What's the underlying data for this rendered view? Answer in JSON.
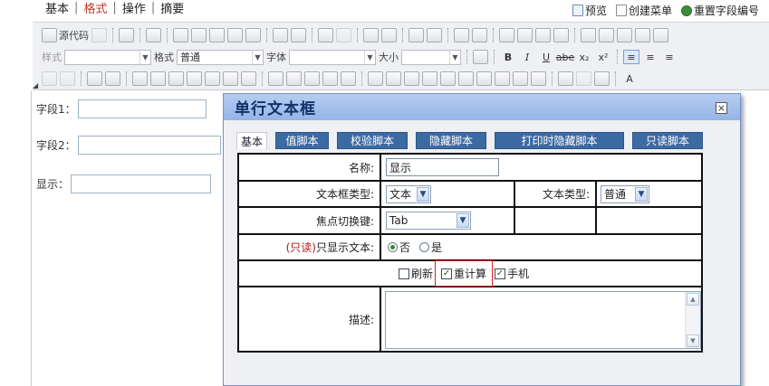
{
  "top_menu": {
    "items": [
      "基本",
      "格式",
      "操作",
      "摘要"
    ],
    "active_index": 1,
    "active_color": "#c0392b"
  },
  "top_actions": {
    "preview": "预览",
    "create_menu": "创建菜单",
    "reset_field_numbers": "重置字段编号"
  },
  "toolbar": {
    "source_code": "源代码",
    "style_label": "样式",
    "format_label": "格式",
    "format_value": "普通",
    "font_label": "字体",
    "size_label": "大小",
    "bold": "B",
    "italic": "I",
    "underline": "U",
    "strike": "abe",
    "subscript": "x₂",
    "superscript": "x²",
    "text_color": "A"
  },
  "left_fields": [
    {
      "label": "字段1："
    },
    {
      "label": "字段2："
    },
    {
      "label": "显示："
    }
  ],
  "dialog": {
    "title": "单行文本框",
    "close": "×",
    "tabs": [
      "基本",
      "值脚本",
      "校验脚本",
      "隐藏脚本",
      "打印时隐藏脚本",
      "只读脚本"
    ],
    "active_tab": 0,
    "tab_color": "#3c6aa2",
    "name_label": "名称:",
    "name_value": "显示",
    "box_type_label": "文本框类型:",
    "box_type_value": "文本",
    "text_type_label": "文本类型:",
    "text_type_value": "普通",
    "focus_key_label": "焦点切换键:",
    "focus_key_value": "Tab",
    "readonly_prefix": "(只读)",
    "readonly_label": "只显示文本:",
    "readonly_options": [
      {
        "label": "否",
        "selected": true
      },
      {
        "label": "是",
        "selected": false
      }
    ],
    "checkboxes": [
      {
        "label": "刷新",
        "checked": false
      },
      {
        "label": "重计算",
        "checked": true
      },
      {
        "label": "手机",
        "checked": true
      }
    ],
    "description_label": "描述:",
    "description_value": ""
  }
}
